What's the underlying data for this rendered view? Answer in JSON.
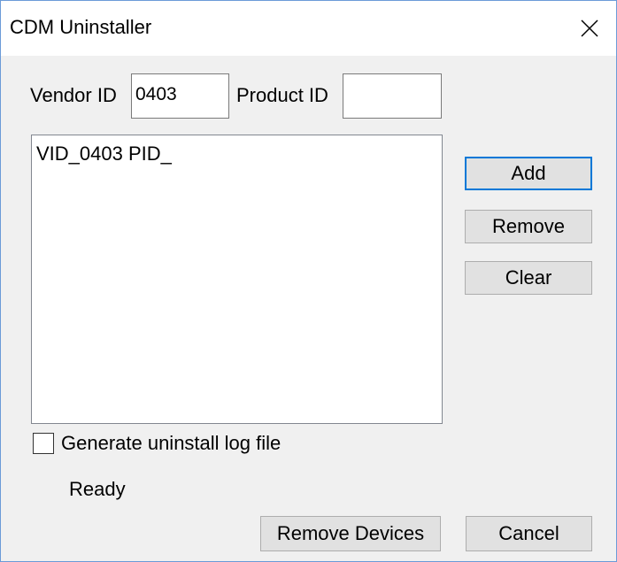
{
  "window": {
    "title": "CDM Uninstaller"
  },
  "form": {
    "vendor_label": "Vendor ID",
    "vendor_value": "0403",
    "product_label": "Product ID",
    "product_value": ""
  },
  "list": {
    "items": [
      "VID_0403 PID_"
    ]
  },
  "buttons": {
    "add": "Add",
    "remove": "Remove",
    "clear": "Clear",
    "remove_devices": "Remove Devices",
    "cancel": "Cancel"
  },
  "options": {
    "log_checkbox_label": "Generate uninstall log file",
    "log_checked": false
  },
  "status": {
    "text": "Ready"
  },
  "icons": {
    "close": "close-icon"
  }
}
